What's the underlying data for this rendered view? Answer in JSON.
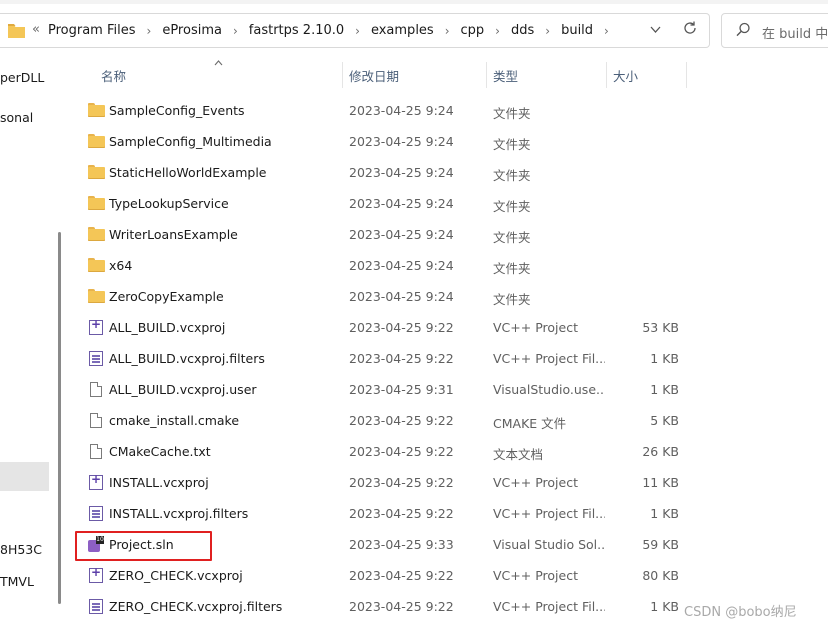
{
  "address": {
    "overflow": "«",
    "crumbs": [
      "Program Files",
      "eProsima",
      "fastrtps 2.10.0",
      "examples",
      "cpp",
      "dds",
      "build"
    ],
    "search_placeholder": "在 build 中搜"
  },
  "nav": {
    "items": [
      "perDLL",
      "sonal",
      "8H53C",
      "TMVL"
    ]
  },
  "columns": {
    "name": "名称",
    "date": "修改日期",
    "type": "类型",
    "size": "大小"
  },
  "rows": [
    {
      "name": "SampleConfig_Events",
      "date": "2023-04-25 9:24",
      "type": "文件夹",
      "size": "",
      "icon": "folder-icon"
    },
    {
      "name": "SampleConfig_Multimedia",
      "date": "2023-04-25 9:24",
      "type": "文件夹",
      "size": "",
      "icon": "folder-icon"
    },
    {
      "name": "StaticHelloWorldExample",
      "date": "2023-04-25 9:24",
      "type": "文件夹",
      "size": "",
      "icon": "folder-icon"
    },
    {
      "name": "TypeLookupService",
      "date": "2023-04-25 9:24",
      "type": "文件夹",
      "size": "",
      "icon": "folder-icon"
    },
    {
      "name": "WriterLoansExample",
      "date": "2023-04-25 9:24",
      "type": "文件夹",
      "size": "",
      "icon": "folder-icon"
    },
    {
      "name": "x64",
      "date": "2023-04-25 9:24",
      "type": "文件夹",
      "size": "",
      "icon": "folder-icon"
    },
    {
      "name": "ZeroCopyExample",
      "date": "2023-04-25 9:24",
      "type": "文件夹",
      "size": "",
      "icon": "folder-icon"
    },
    {
      "name": "ALL_BUILD.vcxproj",
      "date": "2023-04-25 9:22",
      "type": "VC++ Project",
      "size": "53 KB",
      "icon": "vcxproj-icon"
    },
    {
      "name": "ALL_BUILD.vcxproj.filters",
      "date": "2023-04-25 9:22",
      "type": "VC++ Project Fil...",
      "size": "1 KB",
      "icon": "filters-icon"
    },
    {
      "name": "ALL_BUILD.vcxproj.user",
      "date": "2023-04-25 9:31",
      "type": "VisualStudio.use...",
      "size": "1 KB",
      "icon": "file-icon"
    },
    {
      "name": "cmake_install.cmake",
      "date": "2023-04-25 9:22",
      "type": "CMAKE 文件",
      "size": "5 KB",
      "icon": "file-icon"
    },
    {
      "name": "CMakeCache.txt",
      "date": "2023-04-25 9:22",
      "type": "文本文档",
      "size": "26 KB",
      "icon": "text-file-icon"
    },
    {
      "name": "INSTALL.vcxproj",
      "date": "2023-04-25 9:22",
      "type": "VC++ Project",
      "size": "11 KB",
      "icon": "vcxproj-icon"
    },
    {
      "name": "INSTALL.vcxproj.filters",
      "date": "2023-04-25 9:22",
      "type": "VC++ Project Fil...",
      "size": "1 KB",
      "icon": "filters-icon"
    },
    {
      "name": "Project.sln",
      "date": "2023-04-25 9:33",
      "type": "Visual Studio Sol...",
      "size": "59 KB",
      "icon": "sln-icon"
    },
    {
      "name": "ZERO_CHECK.vcxproj",
      "date": "2023-04-25 9:22",
      "type": "VC++ Project",
      "size": "80 KB",
      "icon": "vcxproj-icon"
    },
    {
      "name": "ZERO_CHECK.vcxproj.filters",
      "date": "2023-04-25 9:22",
      "type": "VC++ Project Fil...",
      "size": "1 KB",
      "icon": "filters-icon"
    }
  ],
  "watermark": "CSDN @bobo纳尼"
}
